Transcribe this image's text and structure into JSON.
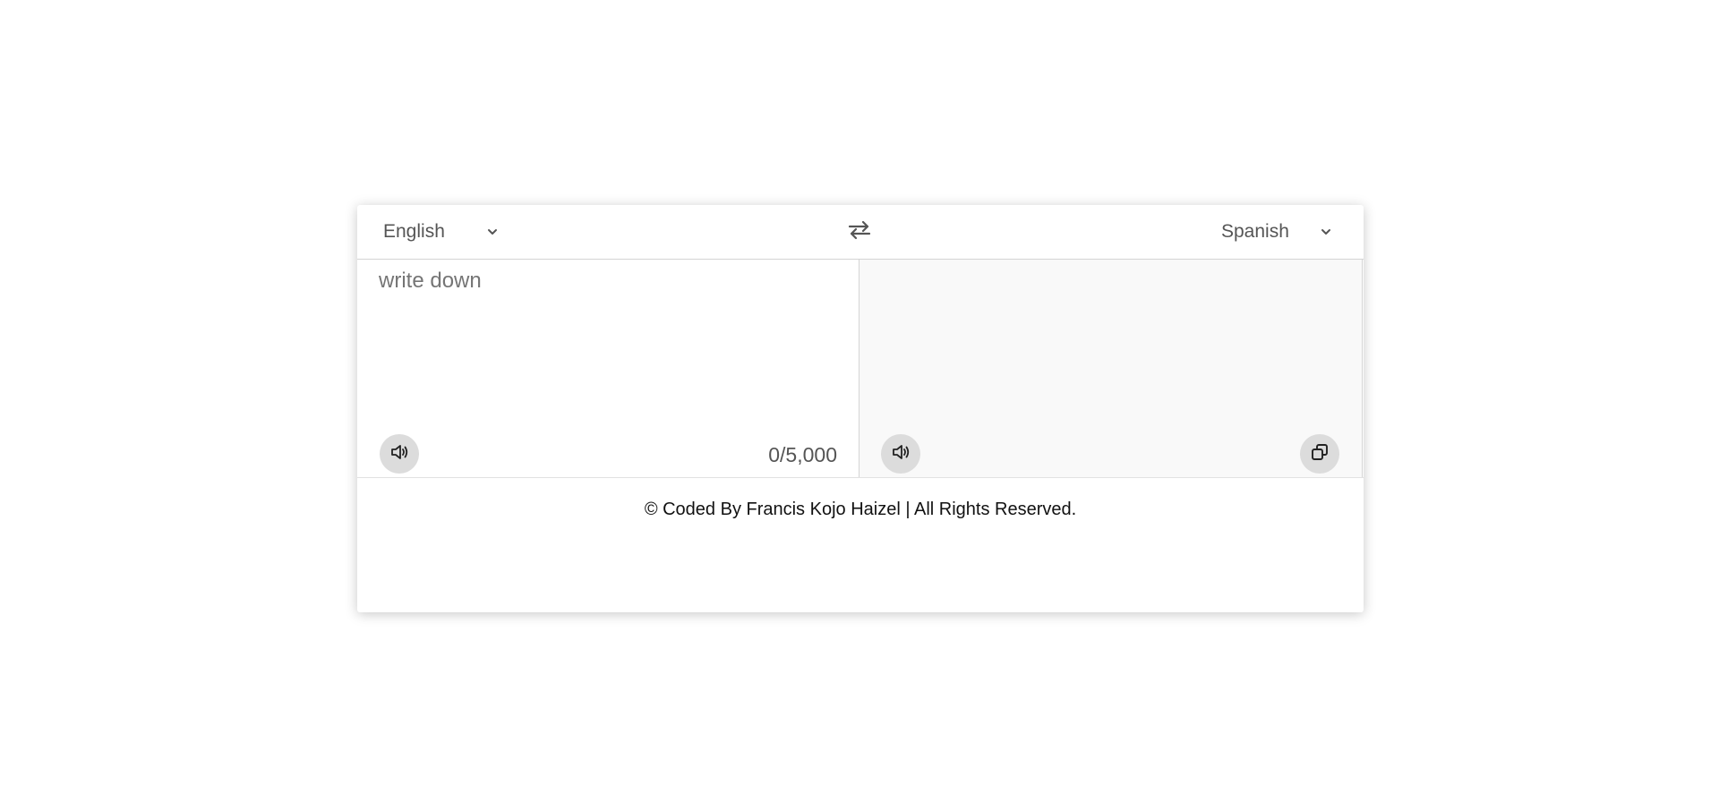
{
  "toolbar": {
    "source_language": "English",
    "target_language": "Spanish",
    "swap_icon": "swap-arrows-icon",
    "chevron_icon": "chevron-down-icon"
  },
  "source": {
    "placeholder": "write down",
    "value": "",
    "counter": "0/5,000",
    "speak_icon": "speaker-icon"
  },
  "target": {
    "value": "",
    "speak_icon": "speaker-icon",
    "copy_icon": "copy-icon"
  },
  "footer": {
    "text": "© Coded By Francis Kojo Haizel | All Rights Reserved."
  },
  "colors": {
    "panel_right_bg": "#f9f9f9",
    "icon_button_bg": "#dcdcdc",
    "text_muted": "#555555"
  }
}
